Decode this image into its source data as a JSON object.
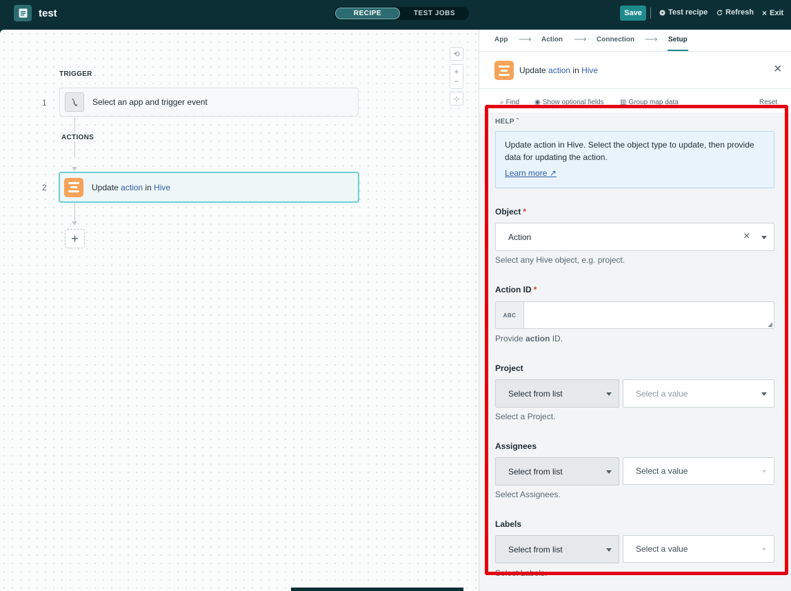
{
  "topbar": {
    "recipe_name": "test",
    "tabs": [
      {
        "label": "RECIPE",
        "active": true
      },
      {
        "label": "TEST JOBS",
        "active": false
      }
    ],
    "save_label": "Save",
    "test_recipe_label": "Test recipe",
    "refresh_label": "Refresh",
    "exit_label": "Exit"
  },
  "canvas": {
    "zoom_controls": [
      "⟲",
      "+",
      "−",
      "⊹"
    ],
    "trigger_label": "TRIGGER",
    "actions_label": "ACTIONS",
    "steps": [
      {
        "number": "1",
        "text": "Select an app and trigger event"
      },
      {
        "number": "2",
        "pre": "Update ",
        "highlight1": "action",
        "mid": " in ",
        "highlight2": "Hive"
      }
    ],
    "add_step_label": "+"
  },
  "panel": {
    "breadcrumbs": [
      "App",
      "Action",
      "Connection",
      "Setup"
    ],
    "active_crumb": "Setup",
    "title": {
      "pre": "Update ",
      "object": "action",
      "mid": " in ",
      "app": "Hive"
    },
    "options": {
      "find": "Find",
      "optional_fields": "Show optional fields",
      "group_map": "Group map data",
      "reset": "Reset"
    },
    "help": {
      "label": "HELP",
      "text": "Update action in Hive. Select the object type to update, then provide data for updating the action.",
      "link": "Learn more"
    },
    "fields": {
      "object": {
        "label": "Object",
        "value": "Action",
        "hint": "Select any Hive object, e.g. project."
      },
      "action_id": {
        "label": "Action ID",
        "type_badge": "ABC",
        "value": "",
        "hint_pre": "Provide ",
        "hint_bold": "action",
        "hint_post": " ID."
      },
      "project": {
        "label": "Project",
        "mode": "Select from list",
        "placeholder": "Select a value",
        "hint": "Select a Project."
      },
      "assignees": {
        "label": "Assignees",
        "mode": "Select from list",
        "placeholder": "Select a value",
        "hint": "Select Assignees."
      },
      "labels": {
        "label": "Labels",
        "mode": "Select from list",
        "placeholder": "Select a value",
        "hint": "Select Labels."
      }
    }
  },
  "colors": {
    "brand_dark": "#0b2f35",
    "accent": "#1f8a8b",
    "hive_orange": "#f5a35a",
    "highlight_frame": "#e3000f"
  }
}
